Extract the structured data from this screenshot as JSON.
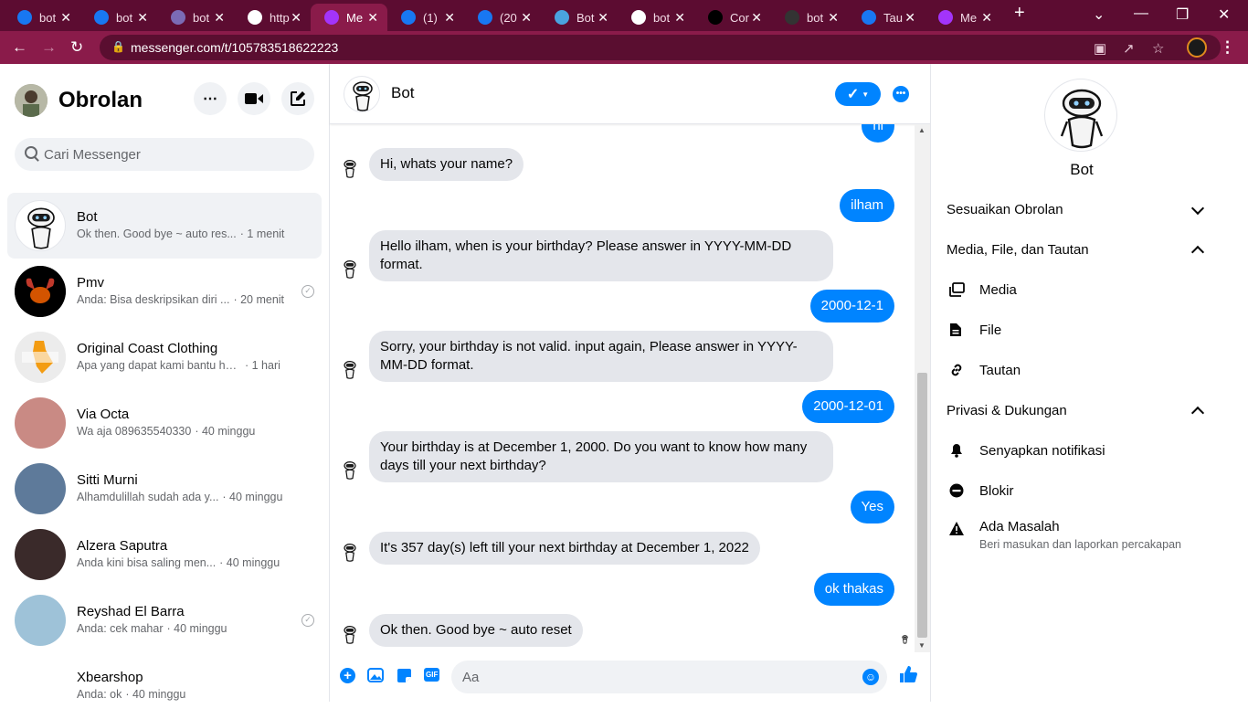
{
  "browser": {
    "tabs": [
      {
        "title": "bot",
        "icon": "facebook-icon",
        "color": "#1877f2"
      },
      {
        "title": "bot",
        "icon": "facebook-icon",
        "color": "#1877f2"
      },
      {
        "title": "bot",
        "icon": "heroku-icon",
        "color": "#7b6bb5"
      },
      {
        "title": "http",
        "icon": "globe-icon",
        "color": "#ffffff"
      },
      {
        "title": "Me",
        "icon": "messenger-icon",
        "color": "#a334fa",
        "active": true
      },
      {
        "title": "(1)",
        "icon": "facebook-icon",
        "color": "#1877f2"
      },
      {
        "title": "(20",
        "icon": "facebook-icon",
        "color": "#1877f2"
      },
      {
        "title": "Bot",
        "icon": "puzzle-icon",
        "color": "#4aa3df"
      },
      {
        "title": "bot",
        "icon": "google-icon",
        "color": "#ffffff"
      },
      {
        "title": "Cor",
        "icon": "dark-circle-icon",
        "color": "#000000"
      },
      {
        "title": "bot",
        "icon": "github-icon",
        "color": "#333333"
      },
      {
        "title": "Tau",
        "icon": "facebook-icon",
        "color": "#1877f2"
      },
      {
        "title": "Me",
        "icon": "messenger-icon",
        "color": "#a334fa"
      }
    ],
    "url": "messenger.com/t/105783518622223",
    "accent": "#8a1b4a",
    "tabbar_bg": "#5c0c31"
  },
  "sidebar": {
    "title": "Obrolan",
    "search_placeholder": "Cari Messenger",
    "conversations": [
      {
        "name": "Bot",
        "preview": "Ok then. Good bye ~ auto res...",
        "time": "· 1 menit",
        "selected": true
      },
      {
        "name": "Pmv",
        "preview": "Anda: Bisa deskripsikan diri ...",
        "time": "· 20 menit",
        "seen": true
      },
      {
        "name": "Original Coast Clothing",
        "preview": "Apa yang dapat kami bantu har...",
        "time": "· 1 hari"
      },
      {
        "name": "Via Octa",
        "preview": "Wa aja 089635540330",
        "time": "· 40 minggu"
      },
      {
        "name": "Sitti Murni",
        "preview": "Alhamdulillah sudah ada y...",
        "time": "· 40 minggu"
      },
      {
        "name": "Alzera Saputra",
        "preview": "Anda kini bisa saling men...",
        "time": "· 40 minggu"
      },
      {
        "name": "Reyshad El Barra",
        "preview": "Anda: cek mahar",
        "time": "· 40 minggu",
        "seen": true
      },
      {
        "name": "Xbearshop",
        "preview": "Anda: ok",
        "time": "· 40 minggu"
      }
    ]
  },
  "chat": {
    "name": "Bot",
    "messages": [
      {
        "from": "me",
        "text": "hi"
      },
      {
        "from": "bot",
        "text": "Hi, whats your name?"
      },
      {
        "from": "me",
        "text": "ilham"
      },
      {
        "from": "bot",
        "text": "Hello ilham, when is your birthday? Please answer in YYYY-MM-DD format."
      },
      {
        "from": "me",
        "text": "2000-12-1"
      },
      {
        "from": "bot",
        "text": "Sorry, your birthday is not valid. input again, Please answer in YYYY-MM-DD format."
      },
      {
        "from": "me",
        "text": "2000-12-01"
      },
      {
        "from": "bot",
        "text": "Your birthday is at December 1, 2000. Do you want to know how many days till your next birthday?"
      },
      {
        "from": "me",
        "text": "Yes"
      },
      {
        "from": "bot",
        "text": "It's 357 day(s) left till your next birthday at December 1, 2022"
      },
      {
        "from": "me",
        "text": "ok thakas"
      },
      {
        "from": "bot",
        "text": "Ok then. Good bye ~ auto reset"
      }
    ],
    "input_placeholder": "Aa",
    "gif_label": "GIF",
    "bubble_color": "#0084ff"
  },
  "details": {
    "name": "Bot",
    "sections": {
      "customize": "Sesuaikan Obrolan",
      "media_files": "Media, File, dan Tautan",
      "media": "Media",
      "file": "File",
      "links": "Tautan",
      "privacy": "Privasi & Dukungan",
      "mute": "Senyapkan notifikasi",
      "block": "Blokir",
      "report": "Ada Masalah",
      "report_sub": "Beri masukan dan laporkan percakapan"
    }
  }
}
